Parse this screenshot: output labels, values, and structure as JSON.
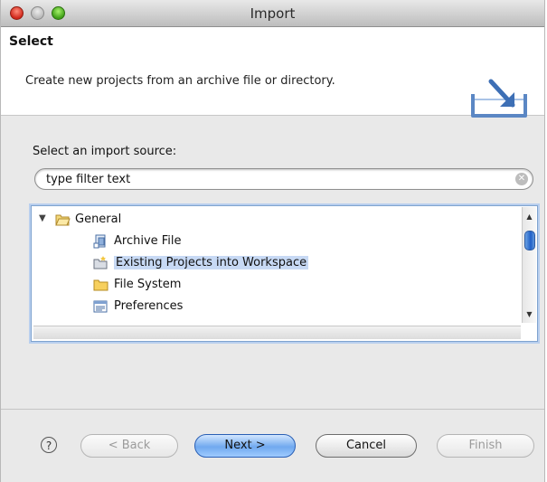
{
  "window": {
    "title": "Import"
  },
  "header": {
    "title": "Select",
    "description": "Create new projects from an archive file or directory."
  },
  "source": {
    "label": "Select an import source:",
    "filter_value": "type filter text"
  },
  "tree": {
    "items": [
      {
        "label": "General",
        "icon": "folder-open-icon",
        "expanded": true,
        "selected": false
      },
      {
        "label": "Archive File",
        "icon": "archive-file-icon",
        "selected": false
      },
      {
        "label": "Existing Projects into Workspace",
        "icon": "projects-icon",
        "selected": true
      },
      {
        "label": "File System",
        "icon": "folder-icon",
        "selected": false
      },
      {
        "label": "Preferences",
        "icon": "preferences-icon",
        "selected": false
      }
    ]
  },
  "buttons": {
    "help": "?",
    "back": "< Back",
    "next": "Next >",
    "cancel": "Cancel",
    "finish": "Finish"
  },
  "colors": {
    "selection": "#c7d9f4",
    "default_button": "#70a9ef",
    "accent": "#1f5fc7"
  }
}
